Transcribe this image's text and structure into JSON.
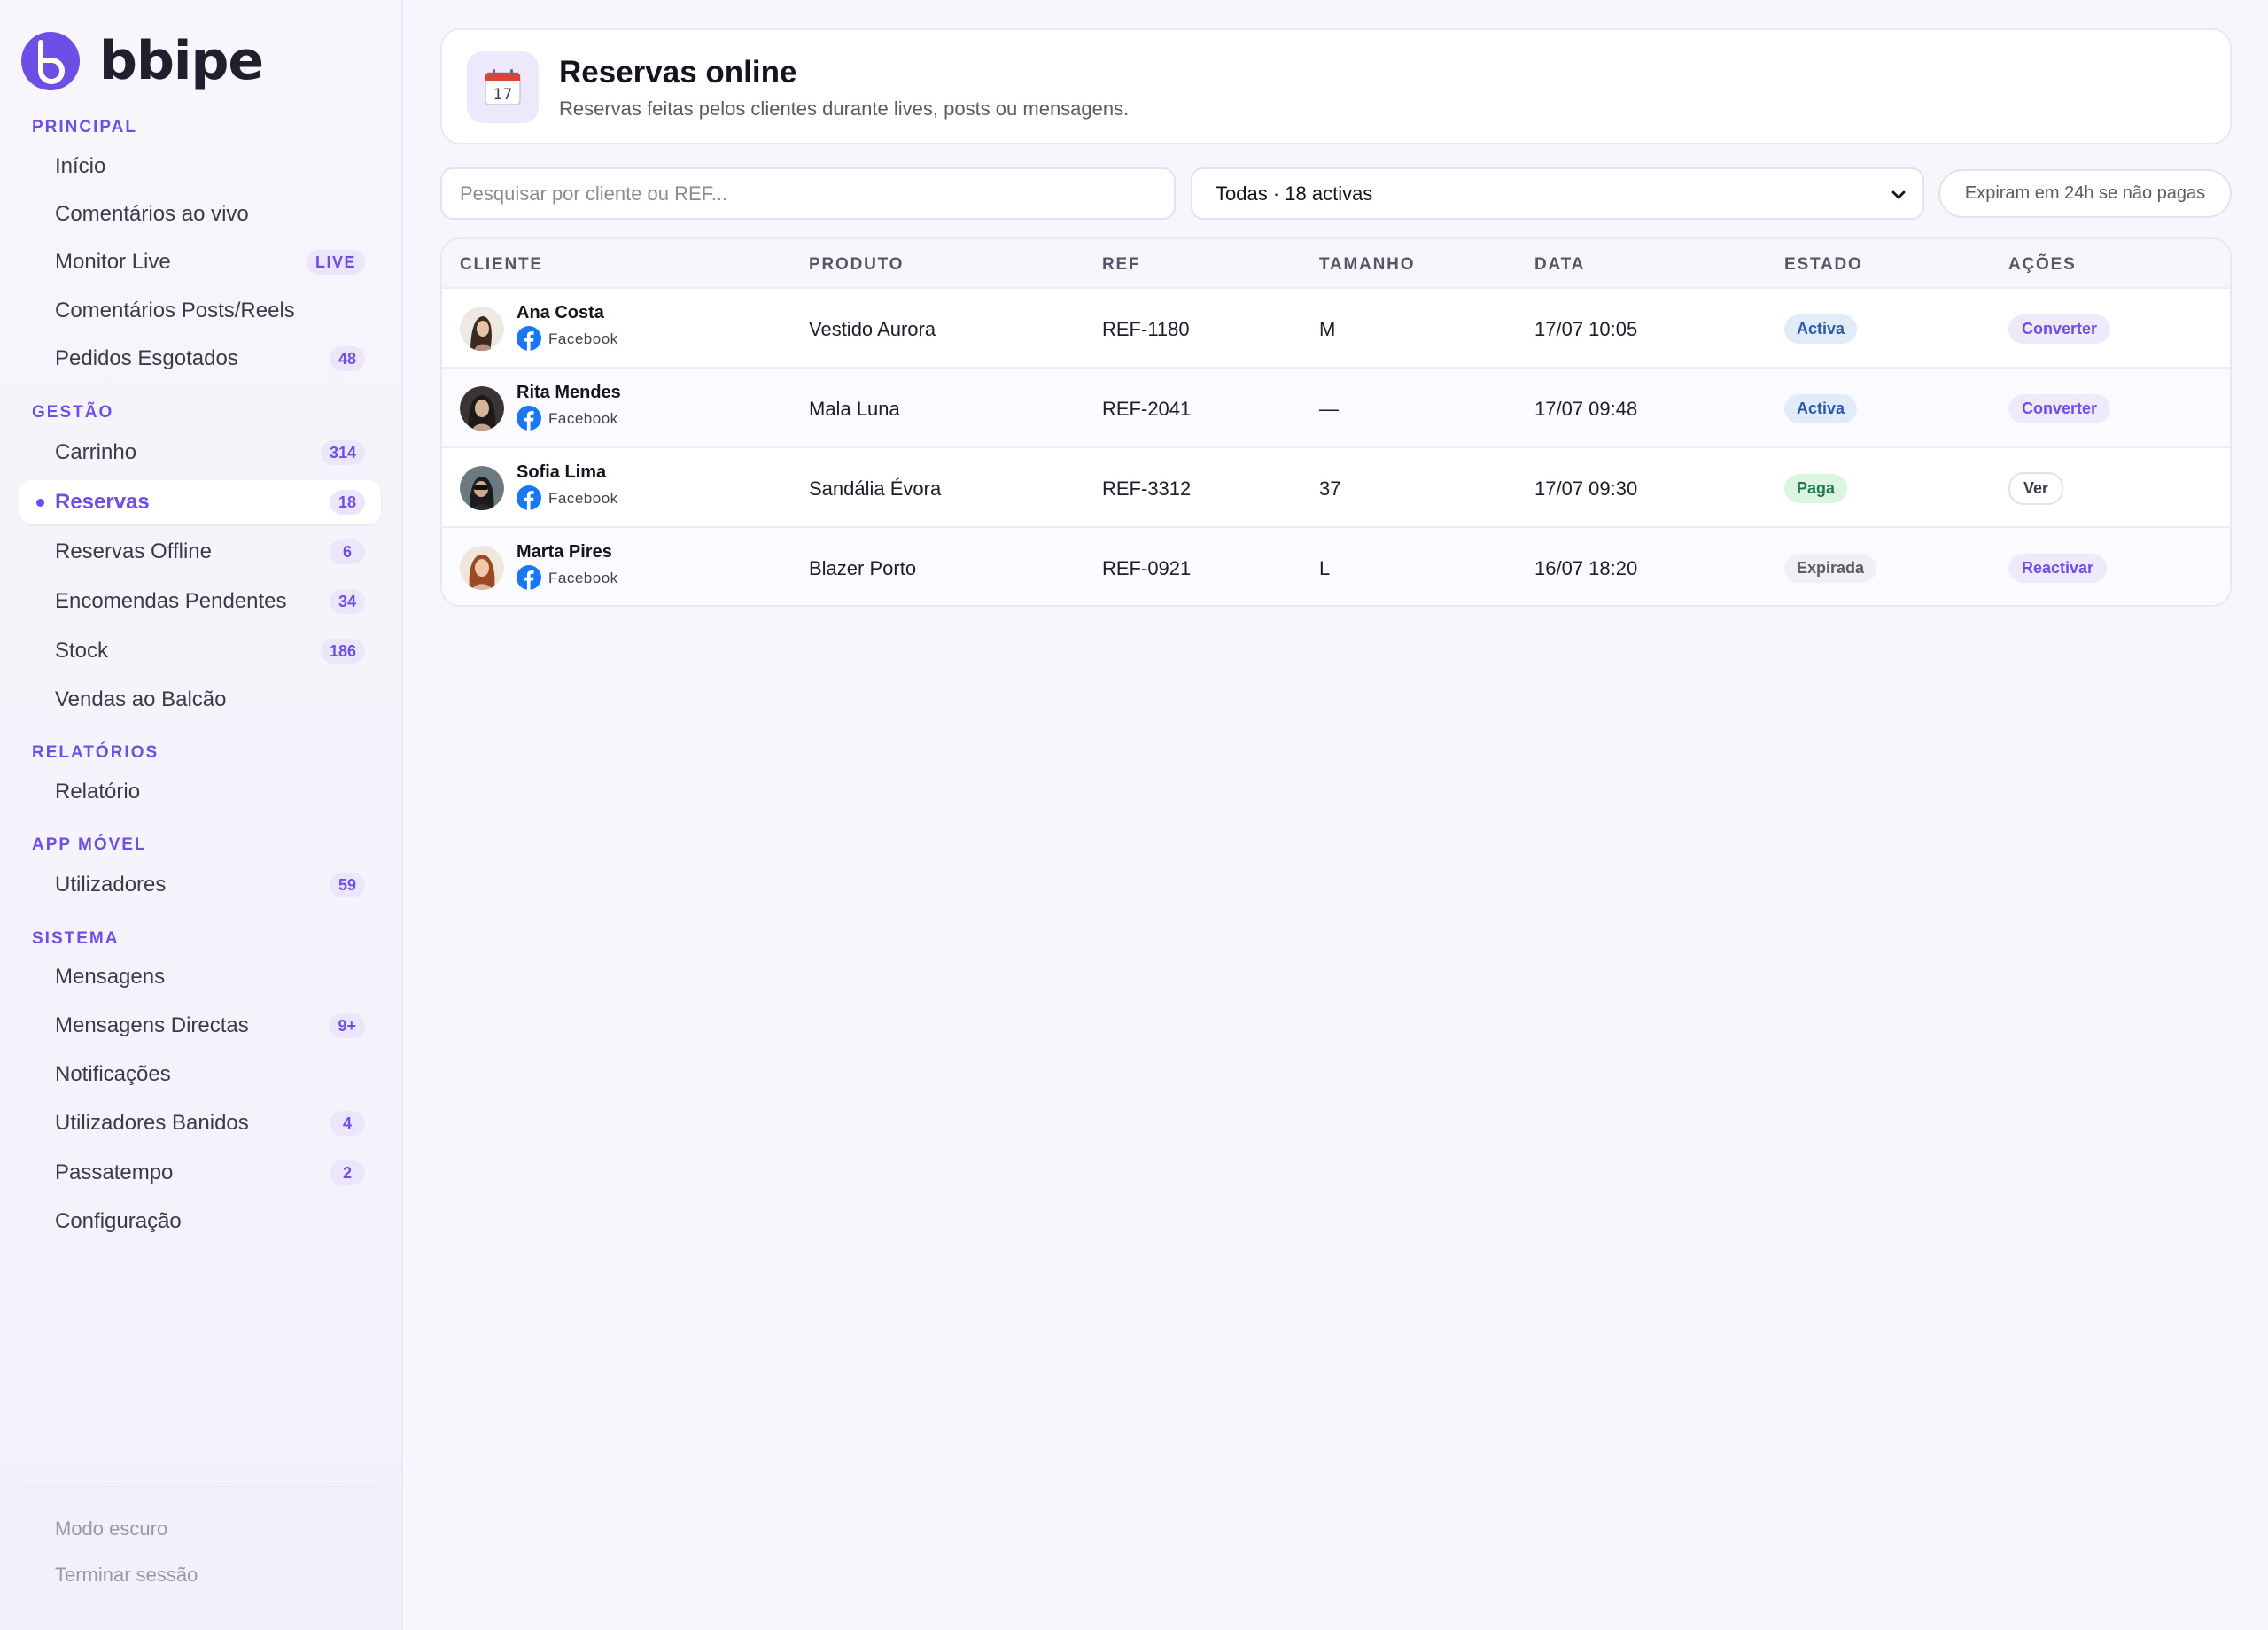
{
  "brand": {
    "name": "bbipe"
  },
  "sidebar": {
    "sections": [
      {
        "title": "PRINCIPAL",
        "items": [
          {
            "label": "Início"
          },
          {
            "label": "Comentários ao vivo"
          },
          {
            "label": "Monitor Live",
            "badge": "LIVE"
          },
          {
            "label": "Comentários Posts/Reels"
          },
          {
            "label": "Pedidos Esgotados",
            "badge": "48"
          }
        ]
      },
      {
        "title": "GESTÃO",
        "items": [
          {
            "label": "Carrinho",
            "badge": "314"
          },
          {
            "label": "Reservas",
            "badge": "18",
            "active": true
          },
          {
            "label": "Reservas Offline",
            "badge": "6"
          },
          {
            "label": "Encomendas Pendentes",
            "badge": "34"
          },
          {
            "label": "Stock",
            "badge": "186"
          },
          {
            "label": "Vendas ao Balcão"
          }
        ]
      },
      {
        "title": "RELATÓRIOS",
        "items": [
          {
            "label": "Relatório"
          }
        ]
      },
      {
        "title": "APP MÓVEL",
        "items": [
          {
            "label": "Utilizadores",
            "badge": "59"
          }
        ]
      },
      {
        "title": "SISTEMA",
        "items": [
          {
            "label": "Mensagens"
          },
          {
            "label": "Mensagens Directas",
            "badge": "9+"
          },
          {
            "label": "Notificações"
          },
          {
            "label": "Utilizadores Banidos",
            "badge": "4"
          },
          {
            "label": "Passatempo",
            "badge": "2"
          },
          {
            "label": "Configuração"
          }
        ]
      }
    ],
    "footer": {
      "dark_mode": "Modo escuro",
      "logout": "Terminar sessão"
    }
  },
  "header": {
    "icon_day": "17",
    "title": "Reservas online",
    "subtitle": "Reservas feitas pelos clientes durante lives, posts ou mensagens."
  },
  "filters": {
    "search_placeholder": "Pesquisar por cliente ou REF...",
    "select_value": "Todas · 18 activas",
    "expire_note": "Expiram em 24h se não pagas"
  },
  "table": {
    "columns": [
      "CLIENTE",
      "PRODUTO",
      "REF",
      "TAMANHO",
      "DATA",
      "ESTADO",
      "AÇÕES"
    ],
    "rows": [
      {
        "name": "Ana Costa",
        "channel": "Facebook",
        "product": "Vestido Aurora",
        "ref": "REF-1180",
        "size": "M",
        "date": "17/07 10:05",
        "status": "Activa",
        "action": "Converter"
      },
      {
        "name": "Rita Mendes",
        "channel": "Facebook",
        "product": "Mala Luna",
        "ref": "REF-2041",
        "size": "—",
        "date": "17/07 09:48",
        "status": "Activa",
        "action": "Converter"
      },
      {
        "name": "Sofia Lima",
        "channel": "Facebook",
        "product": "Sandália Évora",
        "ref": "REF-3312",
        "size": "37",
        "date": "17/07 09:30",
        "status": "Paga",
        "action": "Ver"
      },
      {
        "name": "Marta Pires",
        "channel": "Facebook",
        "product": "Blazer Porto",
        "ref": "REF-0921",
        "size": "L",
        "date": "16/07 18:20",
        "status": "Expirada",
        "action": "Reactivar"
      }
    ]
  },
  "colors": {
    "accent": "#6d4fe6",
    "facebook": "#1877f2"
  }
}
